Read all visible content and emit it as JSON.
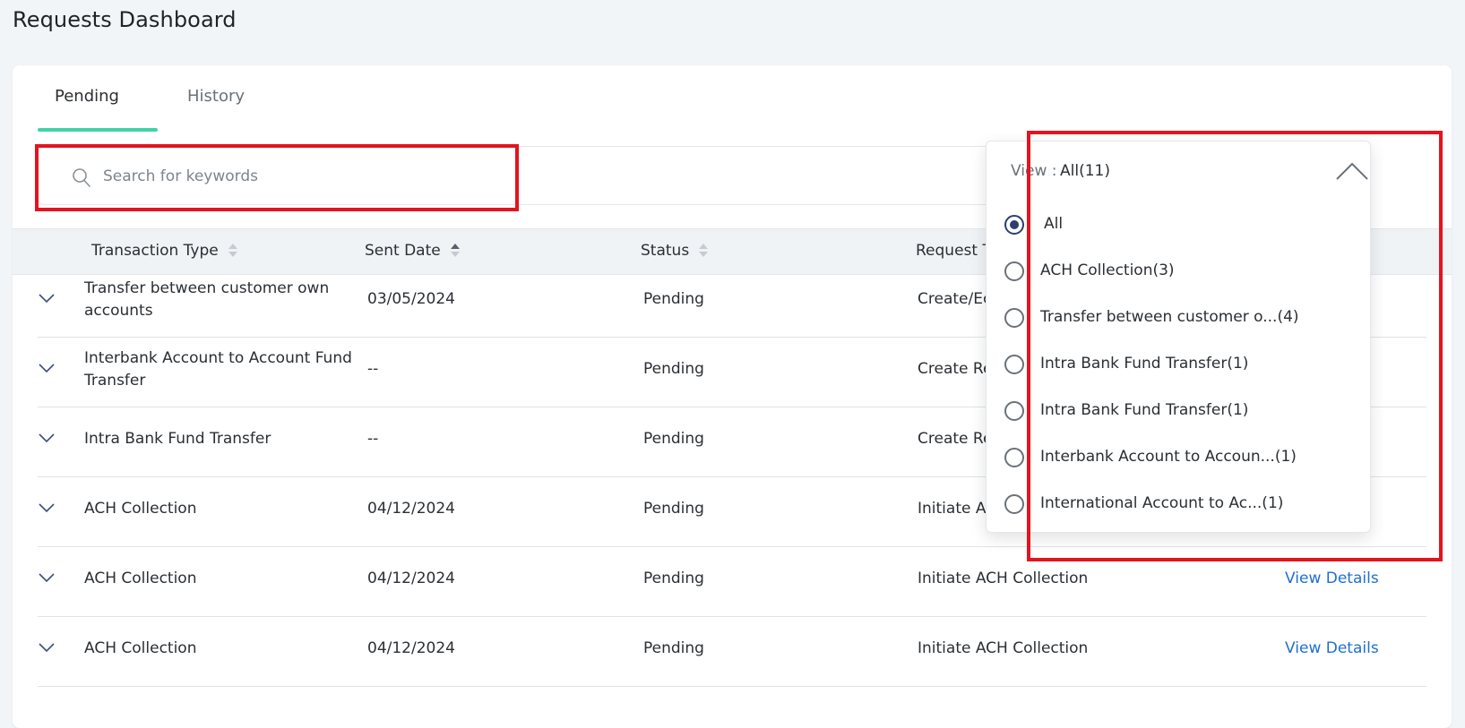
{
  "page": {
    "title": "Requests Dashboard"
  },
  "tabs": [
    {
      "label": "Pending",
      "active": true
    },
    {
      "label": "History",
      "active": false
    }
  ],
  "search": {
    "placeholder": "Search for keywords",
    "value": ""
  },
  "table": {
    "columns": [
      "Transaction Type",
      "Sent Date",
      "Status",
      "Request T"
    ],
    "rows": [
      {
        "type": "Transfer between customer own accounts",
        "date": "03/05/2024",
        "status": "Pending",
        "request": "Create/Ec",
        "action": ""
      },
      {
        "type": "Interbank Account to Account Fund Transfer",
        "date": "--",
        "status": "Pending",
        "request": "Create Re",
        "action": ""
      },
      {
        "type": "Intra Bank Fund Transfer",
        "date": "--",
        "status": "Pending",
        "request": "Create Re",
        "action": ""
      },
      {
        "type": "ACH Collection",
        "date": "04/12/2024",
        "status": "Pending",
        "request": "Initiate AC",
        "action": ""
      },
      {
        "type": "ACH Collection",
        "date": "04/12/2024",
        "status": "Pending",
        "request": "Initiate ACH Collection",
        "action": "View Details"
      },
      {
        "type": "ACH Collection",
        "date": "04/12/2024",
        "status": "Pending",
        "request": "Initiate ACH Collection",
        "action": "View Details"
      }
    ]
  },
  "view_dropdown": {
    "label": "View :",
    "selected": "All(11)",
    "options": [
      {
        "label": "All",
        "checked": true
      },
      {
        "label": "ACH Collection(3)",
        "checked": false
      },
      {
        "label": "Transfer between customer o...(4)",
        "checked": false
      },
      {
        "label": "Intra Bank Fund Transfer(1)",
        "checked": false
      },
      {
        "label": "Intra Bank Fund Transfer(1)",
        "checked": false
      },
      {
        "label": "Interbank Account to Accoun...(1)",
        "checked": false
      },
      {
        "label": "International Account to Ac...(1)",
        "checked": false
      }
    ]
  },
  "colors": {
    "accent": "#3fd3a6",
    "link": "#1f6fd1",
    "highlight": "#e3141e",
    "radio_selected": "#2c3e73"
  }
}
